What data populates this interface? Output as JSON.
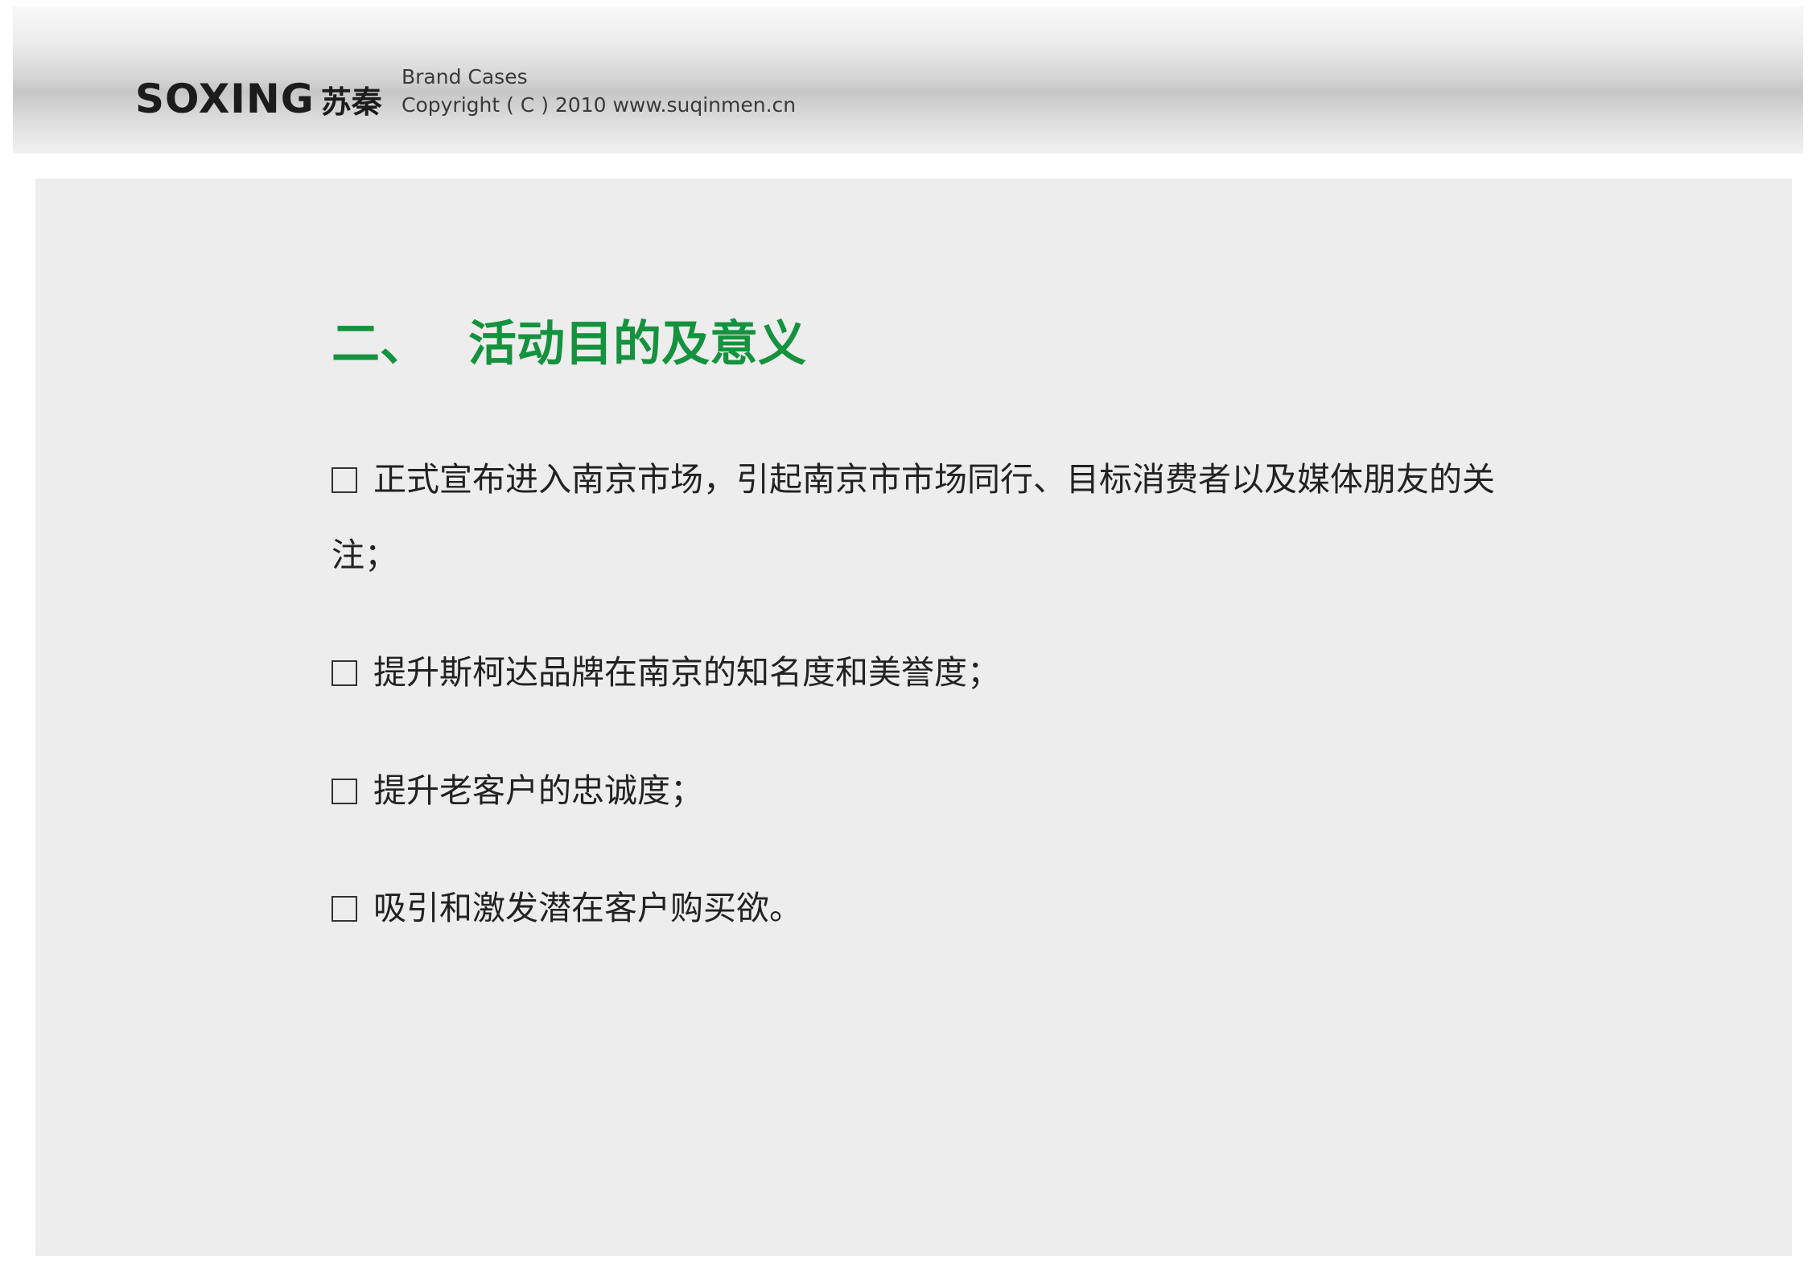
{
  "header": {
    "logo_latin": "SOXING",
    "logo_cn": "苏秦",
    "line1": "Brand Cases",
    "line2": "Copyright ( C ) 2010  www.suqinmen.cn"
  },
  "section": {
    "number": "二、",
    "title": "活动目的及意义"
  },
  "bullets": [
    "正式宣布进入南京市场，引起南京市市场同行、目标消费者以及媒体朋友的关注；",
    "提升斯柯达品牌在南京的知名度和美誉度；",
    "提升老客户的忠诚度；",
    "吸引和激发潜在客户购买欲。"
  ],
  "colors": {
    "title_green": "#15923e",
    "card_bg": "#ededed"
  }
}
